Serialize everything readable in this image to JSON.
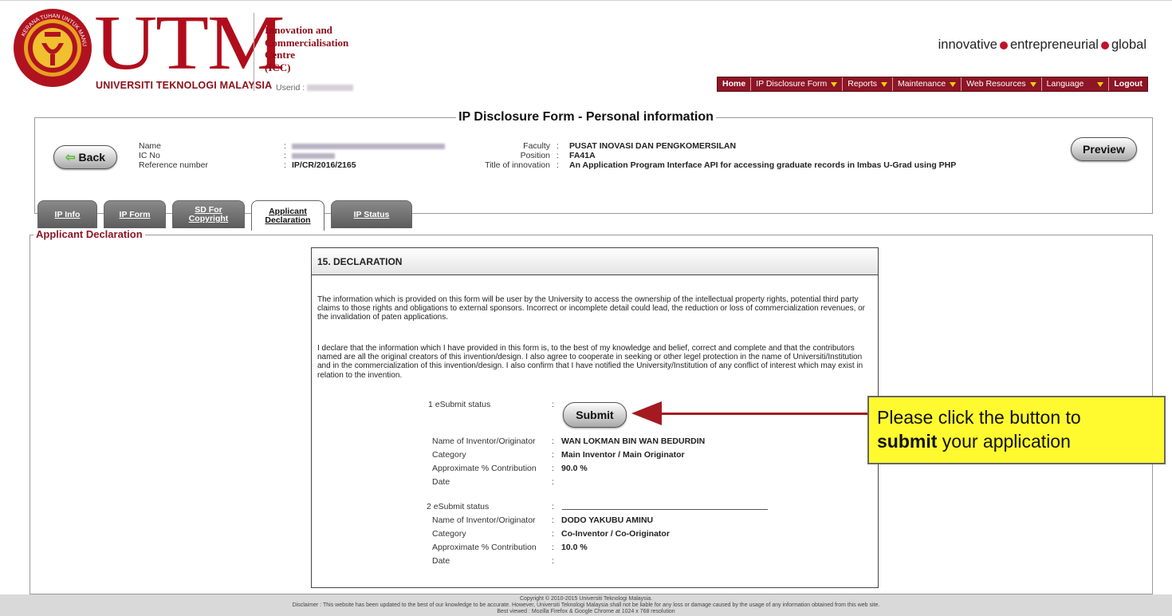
{
  "header": {
    "logo_text": "UTM",
    "university": "UNIVERSITI TEKNOLOGI MALAYSIA",
    "icc_lines": [
      "Innovation and",
      "Commercialisation",
      "Centre",
      "(ICC)"
    ],
    "userid_label": "Userid :",
    "tagline": [
      "innovative",
      "entrepreneurial",
      "global"
    ],
    "menu": [
      {
        "label": "Home",
        "dropdown": false,
        "bold": true
      },
      {
        "label": "IP Disclosure Form",
        "dropdown": true,
        "bold": false
      },
      {
        "label": "Reports",
        "dropdown": true,
        "bold": false
      },
      {
        "label": "Maintenance",
        "dropdown": true,
        "bold": false
      },
      {
        "label": "Web Resources",
        "dropdown": true,
        "bold": false
      },
      {
        "label": "Language",
        "dropdown": true,
        "bold": false
      },
      {
        "label": "Logout",
        "dropdown": false,
        "bold": true
      }
    ]
  },
  "personal_info": {
    "title": "IP Disclosure Form - Personal information",
    "back_label": "Back",
    "preview_label": "Preview",
    "name_label": "Name",
    "ic_label": "IC No",
    "ref_label": "Reference number",
    "ref_value": "IP/CR/2016/2165",
    "faculty_label": "Faculty",
    "faculty_value": "PUSAT INOVASI DAN PENGKOMERSILAN",
    "position_label": "Position",
    "position_value": "FA41A",
    "title_label": "Title of innovation",
    "title_value": "An Application Program Interface API for accessing graduate records in Imbas U-Grad using PHP"
  },
  "tabs": [
    {
      "label_lines": [
        "IP Info"
      ],
      "active": false
    },
    {
      "label_lines": [
        "IP Form"
      ],
      "active": false
    },
    {
      "label_lines": [
        "SD For",
        "Copyright"
      ],
      "active": false
    },
    {
      "label_lines": [
        "Applicant",
        "Declaration"
      ],
      "active": true
    },
    {
      "label_lines": [
        "IP Status"
      ],
      "active": false
    }
  ],
  "declaration": {
    "legend": "Applicant Declaration",
    "heading": "15. DECLARATION",
    "paragraph1": "The information which is provided on this form will be user by the University to access the ownership of the intellectual property rights, potential third party claims to those rights and obligations to external sponsors. Incorrect or incomplete detail could lead, the reduction or loss of commercialization revenues, or the invalidation of paten applications.",
    "paragraph2": "I declare that the information which I have provided in this form is, to the best of my knowledge and belief, correct and complete and that the contributors named are all the original creators of this invention/design. I also agree to cooperate in seeking or other legel protection in the name of Universiti/Institution and in the commercialization of this invention/design. I also confirm that I have notified the University/Institution of any conflict of interest which may exist in relation to the invention.",
    "submit_label": "Submit",
    "labels": {
      "esubmit": "eSubmit status",
      "inventor": "Name of Inventor/Originator",
      "category": "Category",
      "contribution": "Approximate % Contribution",
      "date": "Date"
    },
    "entries": [
      {
        "number": "1",
        "inventor": "WAN LOKMAN BIN WAN BEDURDIN",
        "category": "Main Inventor / Main Originator",
        "contribution": "90.0 %",
        "date": ""
      },
      {
        "number": "2",
        "inventor": "DODO YAKUBU AMINU",
        "category": "Co-Inventor / Co-Originator",
        "contribution": "10.0 %",
        "date": ""
      }
    ]
  },
  "callout": {
    "line1": "Please click the button to",
    "bold_word": "submit",
    "line2_rest": " your application"
  },
  "footer": {
    "copyright": "Copyright © 2010-2015 Universiti Teknologi Malaysia.",
    "disclaimer": "Disclaimer : This website has been updated to the best of our knowledge to be accurate. However, Universiti Teknologi Malaysia shall not be liable for any loss or damage caused by the usage of any information obtained from this web site.",
    "best_viewed": "Best viewed : Mozilla Firefox & Google Chrome at 1024 x 768 resolution"
  },
  "colors": {
    "brand_red": "#b00d1c",
    "menu_bg": "#8d1526",
    "callout_bg": "#fff930",
    "arrow": "#a41a20"
  }
}
